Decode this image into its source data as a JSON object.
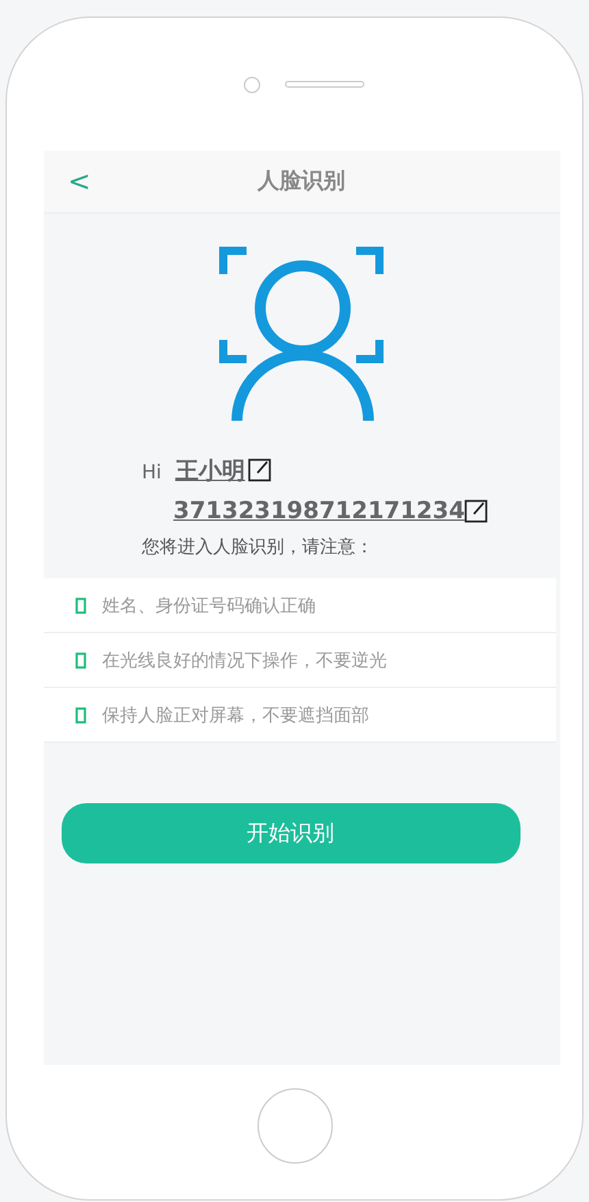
{
  "header": {
    "back": "<",
    "title": "人脸识别"
  },
  "greeting": {
    "hi": "Hi",
    "name": "王小明",
    "id_number": "371323198712171234",
    "notice": "您将进入人脸识别，请注意："
  },
  "tips": [
    {
      "text": "姓名、身份证号码确认正确"
    },
    {
      "text": "在光线良好的情况下操作，不要逆光"
    },
    {
      "text": "保持人脸正对屏幕，不要遮挡面部"
    }
  ],
  "start_button": "开始识别"
}
